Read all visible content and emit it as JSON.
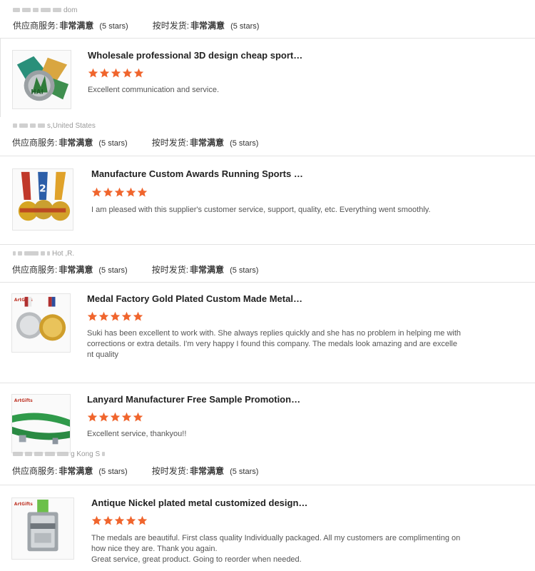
{
  "colors": {
    "star": "#f0652d",
    "divider": "#e3e3e3",
    "text": "#333333"
  },
  "icons": {
    "rating_star": "star-icon"
  },
  "service_labels": {
    "supplier_service": "供应商服务:",
    "on_time_shipping": "按时发货:",
    "very_satisfied": "非常满意",
    "five_stars": "(5 stars)"
  },
  "top_location": "dom",
  "reviews": [
    {
      "location": "s,United States",
      "title": "Wholesale professional 3D design cheap sport…",
      "rating": 5,
      "text": "Excellent communication and service."
    },
    {
      "location": "Hot ,R.",
      "title": "Manufacture Custom Awards Running Sports …",
      "rating": 5,
      "text": "I am pleased with this supplier's customer service, support, quality, etc. Everything went smoothly."
    },
    {
      "location": "",
      "title": "Medal Factory Gold Plated Custom Made Metal…",
      "rating": 5,
      "text_lines": [
        "Suki has been excellent to work with. She always replies quickly and she has no problem in helping me with",
        "corrections or extra details. I'm very happy I found this company. The medals look amazing and are excelle",
        "nt quality"
      ]
    },
    {
      "location": "g Kong S",
      "title": "Lanyard Manufacturer Free Sample Promotion…",
      "rating": 5,
      "text": "Excellent service, thankyou!!"
    },
    {
      "location": "",
      "title": "Antique Nickel plated metal customized design…",
      "rating": 5,
      "text_lines": [
        "The medals are beautiful. First class quality Individually packaged. All my customers are complimenting on",
        "how nice they are. Thank you again.",
        "Great service, great product. Going to reorder when needed."
      ]
    }
  ]
}
